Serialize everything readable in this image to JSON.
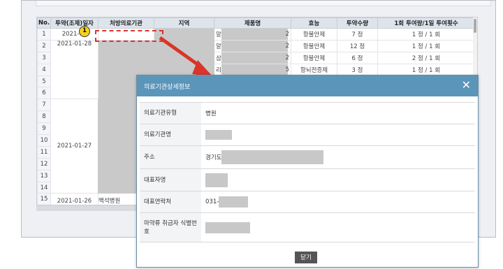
{
  "grid": {
    "headers": [
      "No.",
      "투약(조제)일자",
      "처방의료기관",
      "지역",
      "제품명",
      "효능",
      "투약수량",
      "1회 투여량/1일 투여횟수"
    ],
    "rows": [
      {
        "no": "1",
        "date": "2021-02",
        "product_tail": "2",
        "efficacy": "항불안제",
        "qty": "7 정",
        "dose": "1 정 / 1 회"
      },
      {
        "no": "2",
        "date": "2021-01-28",
        "product_tail": "2",
        "efficacy": "항불안제",
        "qty": "12 정",
        "dose": "1 정 / 1 회"
      },
      {
        "no": "3",
        "date": "",
        "product_prefix": "삼",
        "product_tail": "2",
        "efficacy": "항불안제",
        "qty": "6 정",
        "dose": "2 정 / 1 회"
      },
      {
        "no": "4",
        "date": "",
        "product_prefix": "리",
        "product_tail": "5",
        "efficacy": "항뇌전증제",
        "qty": "3 정",
        "dose": "1 정 / 1 회"
      },
      {
        "no": "5",
        "date": ""
      },
      {
        "no": "6",
        "date": ""
      },
      {
        "no": "7",
        "date": ""
      },
      {
        "no": "8",
        "date": "2021-01-27"
      },
      {
        "no": "9",
        "date": ""
      },
      {
        "no": "10",
        "date": ""
      },
      {
        "no": "11",
        "date": ""
      },
      {
        "no": "12",
        "date": ""
      },
      {
        "no": "13",
        "date": ""
      },
      {
        "no": "14",
        "date": ""
      },
      {
        "no": "15",
        "date": "2021-01-26",
        "institution": "백석병원"
      }
    ],
    "first_row_product_prefix": "알",
    "second_row_product_prefix": "알"
  },
  "callout": {
    "badge": "1"
  },
  "modal": {
    "title": "의료기관상세정보",
    "close_glyph": "✕",
    "fields": [
      {
        "label": "의료기관유형",
        "value": "병원"
      },
      {
        "label": "의료기관명",
        "value": ""
      },
      {
        "label": "주소",
        "value": "경기도"
      },
      {
        "label": "대표자명",
        "value": ""
      },
      {
        "label": "대표연락처",
        "value": "031-"
      },
      {
        "label": "마약류 취급자 식별번호",
        "value": ""
      }
    ],
    "close_button": "닫기"
  },
  "colors": {
    "accent": "#5b95b9",
    "callout": "#d9352a",
    "badge": "#f7d21c"
  }
}
